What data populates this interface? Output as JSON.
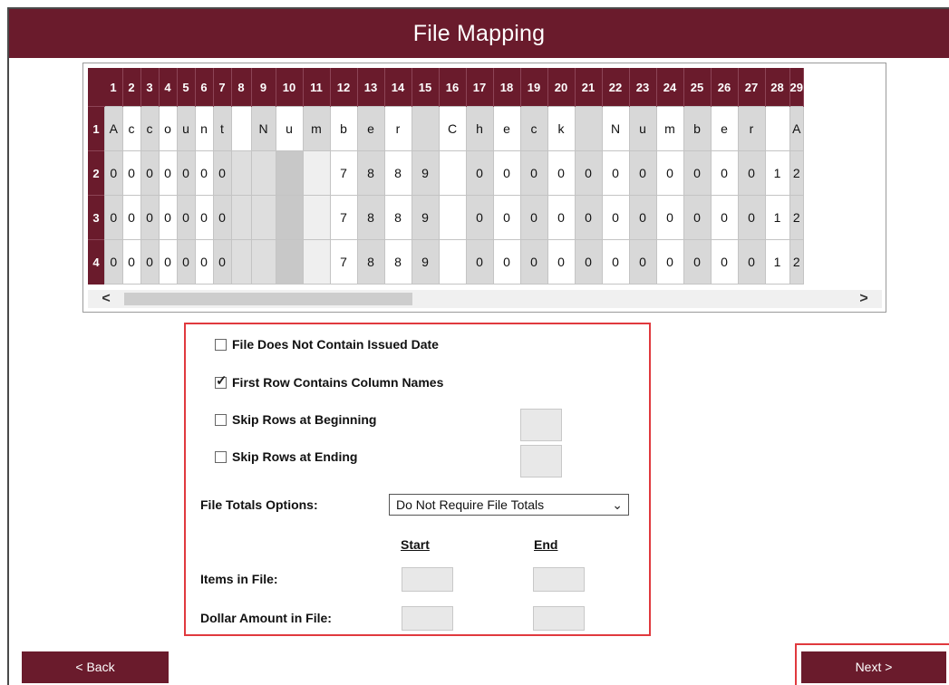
{
  "header": {
    "title": "File Mapping"
  },
  "grid": {
    "columns": [
      "1",
      "2",
      "3",
      "4",
      "5",
      "6",
      "7",
      "8",
      "9",
      "10",
      "11",
      "12",
      "13",
      "14",
      "15",
      "16",
      "17",
      "18",
      "19",
      "20",
      "21",
      "22",
      "23",
      "24",
      "25",
      "26",
      "27",
      "28",
      "29"
    ],
    "rows": [
      {
        "label": "1",
        "cells": [
          "A",
          "c",
          "c",
          "o",
          "u",
          "n",
          "t",
          "",
          "N",
          "u",
          "m",
          "b",
          "e",
          "r",
          "",
          "C",
          "h",
          "e",
          "c",
          "k",
          "",
          "N",
          "u",
          "m",
          "b",
          "e",
          "r",
          "",
          "A"
        ]
      },
      {
        "label": "2",
        "cells": [
          "0",
          "0",
          "0",
          "0",
          "0",
          "0",
          "0",
          "",
          "",
          "",
          "",
          "7",
          "8",
          "8",
          "9",
          "",
          "0",
          "0",
          "0",
          "0",
          "0",
          "0",
          "0",
          "0",
          "0",
          "0",
          "0",
          "1",
          "2"
        ]
      },
      {
        "label": "3",
        "cells": [
          "0",
          "0",
          "0",
          "0",
          "0",
          "0",
          "0",
          "",
          "",
          "",
          "",
          "7",
          "8",
          "8",
          "9",
          "",
          "0",
          "0",
          "0",
          "0",
          "0",
          "0",
          "0",
          "0",
          "0",
          "0",
          "0",
          "1",
          "2"
        ]
      },
      {
        "label": "4",
        "cells": [
          "0",
          "0",
          "0",
          "0",
          "0",
          "0",
          "0",
          "",
          "",
          "",
          "",
          "7",
          "8",
          "8",
          "9",
          "",
          "0",
          "0",
          "0",
          "0",
          "0",
          "0",
          "0",
          "0",
          "0",
          "0",
          "0",
          "1",
          "2"
        ]
      }
    ],
    "scroll_left": "<",
    "scroll_right": ">"
  },
  "options": {
    "no_issued_date": {
      "label": "File Does Not Contain Issued Date",
      "checked": false
    },
    "first_row_names": {
      "label": "First Row Contains Column Names",
      "checked": true
    },
    "skip_beginning": {
      "label": "Skip Rows at Beginning",
      "checked": false,
      "value": ""
    },
    "skip_ending": {
      "label": "Skip Rows at Ending",
      "checked": false,
      "value": ""
    },
    "file_totals_label": "File Totals Options:",
    "file_totals_selected": "Do Not Require File Totals",
    "start_header": "Start",
    "end_header": "End",
    "items_label": "Items in File:",
    "dollar_label": "Dollar Amount in File:",
    "check_mark": "✓"
  },
  "footer": {
    "back_label": "< Back",
    "next_label": "Next >"
  },
  "colors": {
    "brand": "#6a1b2c",
    "highlight": "#e0393e"
  }
}
